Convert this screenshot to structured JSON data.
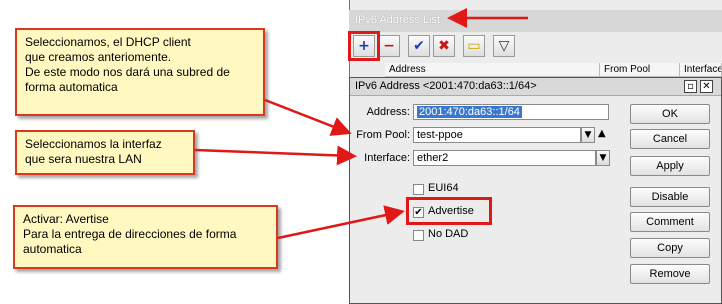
{
  "list_window": {
    "title": "IPv6 Address List",
    "columns": [
      "Address",
      "From Pool",
      "Interface"
    ]
  },
  "toolbar": {
    "add_glyph": "+",
    "remove_glyph": "−",
    "enable_glyph": "✔",
    "disable_glyph": "✖",
    "comment_glyph": "▭",
    "filter_glyph": "▽"
  },
  "dialog": {
    "title": "IPv6 Address <2001:470:da63::1/64>",
    "address_label": "Address:",
    "address_value": "2001:470:da63::1/64",
    "from_pool_label": "From Pool:",
    "from_pool_value": "test-ppoe",
    "interface_label": "Interface:",
    "interface_value": "ether2",
    "eui64_label": "EUI64",
    "advertise_label": "Advertise",
    "nodad_label": "No DAD",
    "buttons": {
      "ok": "OK",
      "cancel": "Cancel",
      "apply": "Apply",
      "disable": "Disable",
      "comment": "Comment",
      "copy": "Copy",
      "remove": "Remove"
    }
  },
  "callouts": {
    "dhcp": [
      "Seleccionamos, el DHCP client",
      "que creamos anteriomente.",
      "De este modo nos dará una subred de",
      "forma automatica"
    ],
    "interface": [
      "Seleccionamos la interfaz",
      "que sera nuestra LAN"
    ],
    "advertise": [
      "Activar: Avertise",
      "Para la entrega de direcciones de forma",
      "automatica"
    ]
  },
  "colors": {
    "accent_red": "#e01818",
    "note_fill": "#fff8c0",
    "selection": "#3a78d0"
  }
}
